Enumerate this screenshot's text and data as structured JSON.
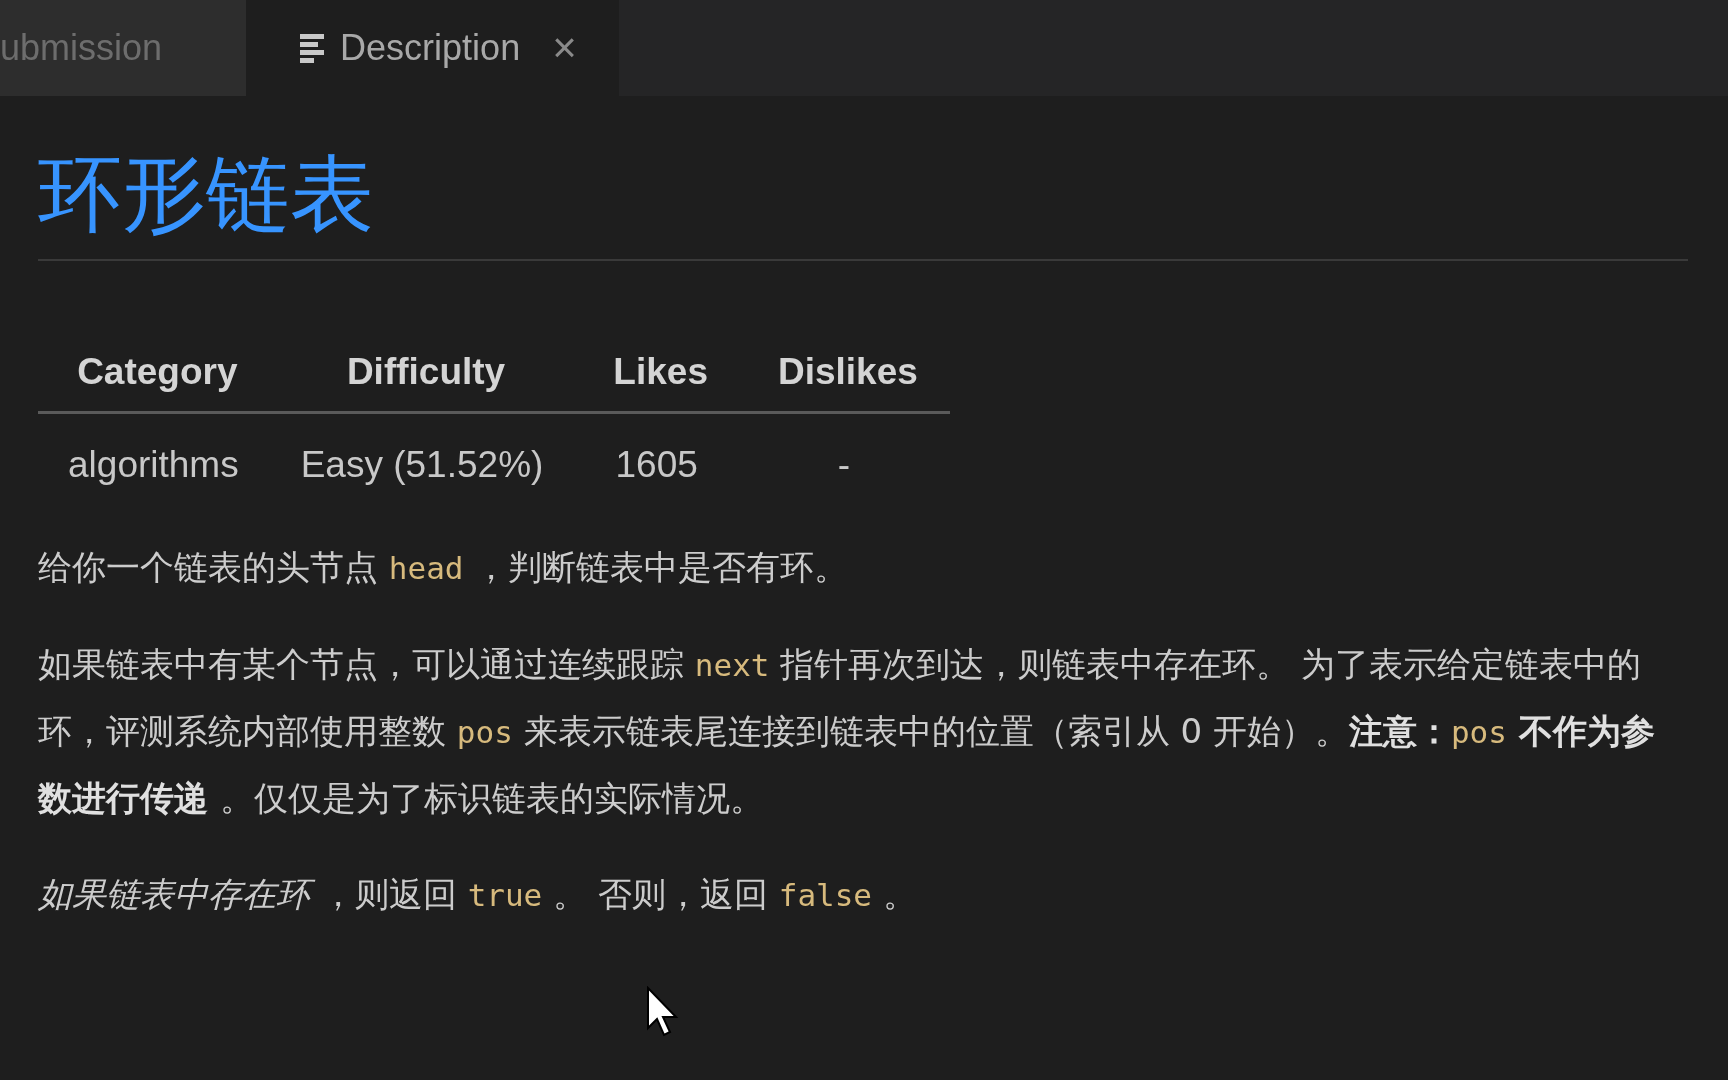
{
  "tabs": [
    {
      "label": "ubmission",
      "selected": false,
      "closable": false
    },
    {
      "label": "Description",
      "selected": true,
      "closable": true,
      "close_glyph": "×"
    }
  ],
  "title": "环形链表",
  "table": {
    "columns": [
      "Category",
      "Difficulty",
      "Likes",
      "Dislikes"
    ],
    "rows": [
      [
        "algorithms",
        "Easy (51.52%)",
        "1605",
        "-"
      ]
    ]
  },
  "paragraphs": [
    [
      {
        "kind": "text",
        "text": "给你一个链表的头节点 "
      },
      {
        "kind": "code",
        "text": "head"
      },
      {
        "kind": "text",
        "text": " ，判断链表中是否有环。"
      }
    ],
    [
      {
        "kind": "text",
        "text": "如果链表中有某个节点，可以通过连续跟踪 "
      },
      {
        "kind": "code",
        "text": "next"
      },
      {
        "kind": "text",
        "text": " 指针再次到达，则链表中存在环。 为了表示给定链表中的环，评测系统内部使用整数 "
      },
      {
        "kind": "code",
        "text": "pos"
      },
      {
        "kind": "text",
        "text": " 来表示链表尾连接到链表中的位置（索引从 0 开始）。"
      },
      {
        "kind": "bold",
        "text": "注意："
      },
      {
        "kind": "code",
        "text": "pos"
      },
      {
        "kind": "bold",
        "text": " 不作为参数进行传递 "
      },
      {
        "kind": "text",
        "text": "。仅仅是为了标识链表的实际情况。"
      }
    ],
    [
      {
        "kind": "italic",
        "text": "如果链表中存在环"
      },
      {
        "kind": "text",
        "text": " ，则返回 "
      },
      {
        "kind": "code",
        "text": "true"
      },
      {
        "kind": "text",
        "text": " 。 否则，返回 "
      },
      {
        "kind": "code",
        "text": "false"
      },
      {
        "kind": "text",
        "text": " 。"
      }
    ]
  ]
}
